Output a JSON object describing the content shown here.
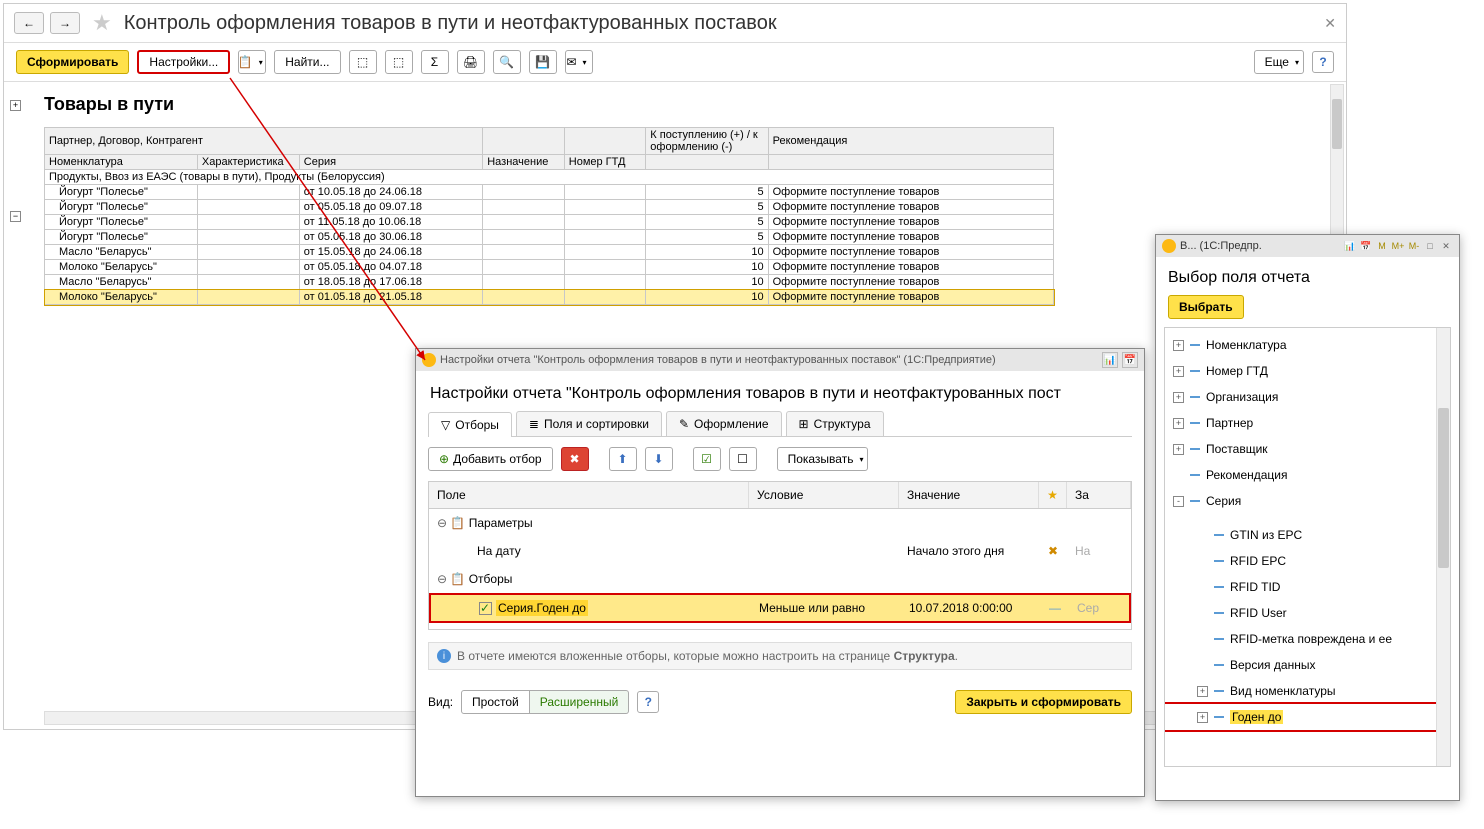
{
  "main": {
    "title": "Контроль оформления товаров в пути и неотфактурованных поставок",
    "toolbar": {
      "generate": "Сформировать",
      "settings": "Настройки...",
      "find": "Найти...",
      "more": "Еще"
    }
  },
  "report": {
    "title": "Товары в пути",
    "header1": {
      "c1": "Партнер, Договор, Контрагент",
      "c5": "К поступлению (+) / к оформлению (-)",
      "c6": "Рекомендация"
    },
    "header2": {
      "c1": "Номенклатура",
      "c2": "Характеристика",
      "c3": "Серия",
      "c4": "Назначение",
      "c5": "Номер ГТД"
    },
    "group_row": "Продукты, Ввоз из ЕАЭС (товары в пути), Продукты (Белоруссия)",
    "rows": [
      {
        "name": "Йогурт \"Полесье\"",
        "series": "от 10.05.18 до 24.06.18",
        "qty": "5",
        "rec": "Оформите поступление товаров"
      },
      {
        "name": "Йогурт \"Полесье\"",
        "series": "от 05.05.18 до 09.07.18",
        "qty": "5",
        "rec": "Оформите поступление товаров"
      },
      {
        "name": "Йогурт \"Полесье\"",
        "series": "от 11.05.18 до 10.06.18",
        "qty": "5",
        "rec": "Оформите поступление товаров"
      },
      {
        "name": "Йогурт \"Полесье\"",
        "series": "от 05.05.18 до 30.06.18",
        "qty": "5",
        "rec": "Оформите поступление товаров"
      },
      {
        "name": "Масло \"Беларусь\"",
        "series": "от 15.05.18 до 24.06.18",
        "qty": "10",
        "rec": "Оформите поступление товаров"
      },
      {
        "name": "Молоко \"Беларусь\"",
        "series": "от 05.05.18 до 04.07.18",
        "qty": "10",
        "rec": "Оформите поступление товаров"
      },
      {
        "name": "Масло \"Беларусь\"",
        "series": "от 18.05.18 до 17.06.18",
        "qty": "10",
        "rec": "Оформите поступление товаров"
      },
      {
        "name": "Молоко \"Беларусь\"",
        "series": "от 01.05.18 до 21.05.18",
        "qty": "10",
        "rec": "Оформите поступление товаров"
      }
    ]
  },
  "settings_dialog": {
    "winbar": "Настройки отчета \"Контроль оформления товаров в пути и неотфактурованных поставок\" (1С:Предприятие)",
    "heading": "Настройки отчета \"Контроль оформления товаров в пути и неотфактурованных пост",
    "tabs": {
      "filters": "Отборы",
      "fields": "Поля и сортировки",
      "design": "Оформление",
      "structure": "Структура"
    },
    "filter_toolbar": {
      "add": "Добавить отбор",
      "show": "Показывать"
    },
    "columns": {
      "field": "Поле",
      "condition": "Условие",
      "value": "Значение",
      "star": "★",
      "head": "За"
    },
    "groups": {
      "params": "Параметры",
      "on_date": "На дату",
      "filters": "Отборы"
    },
    "param_value": "Начало этого дня",
    "param_head": "На",
    "sel_row": {
      "field": "Серия.Годен до",
      "cond": "Меньше или равно",
      "value": "10.07.2018 0:00:00",
      "head": "Сер"
    },
    "info_text_a": "В отчете имеются вложенные отборы, которые можно настроить на странице ",
    "info_text_b": "Структура",
    "footer": {
      "view": "Вид:",
      "simple": "Простой",
      "ext": "Расширенный",
      "close": "Закрыть и сформировать"
    }
  },
  "chooser": {
    "winbar": "В... (1С:Предпр.",
    "heading": "Выбор поля отчета",
    "select_btn": "Выбрать",
    "m": "M",
    "mplus": "M+",
    "mminus": "M-",
    "nodes_top": [
      {
        "label": "Номенклатура",
        "pm": "+"
      },
      {
        "label": "Номер ГТД",
        "pm": "+"
      },
      {
        "label": "Организация",
        "pm": "+"
      },
      {
        "label": "Партнер",
        "pm": "+"
      },
      {
        "label": "Поставщик",
        "pm": "+"
      },
      {
        "label": "Рекомендация",
        "pm": ""
      },
      {
        "label": "Серия",
        "pm": "-"
      }
    ],
    "nodes_series_children": [
      {
        "label": "GTIN из EPC",
        "pm": ""
      },
      {
        "label": "RFID EPC",
        "pm": ""
      },
      {
        "label": "RFID TID",
        "pm": ""
      },
      {
        "label": "RFID User",
        "pm": ""
      },
      {
        "label": "RFID-метка повреждена и ее",
        "pm": ""
      },
      {
        "label": "Версия данных",
        "pm": ""
      },
      {
        "label": "Вид номенклатуры",
        "pm": "+"
      },
      {
        "label": "Годен до",
        "pm": "+",
        "sel": true
      }
    ]
  }
}
